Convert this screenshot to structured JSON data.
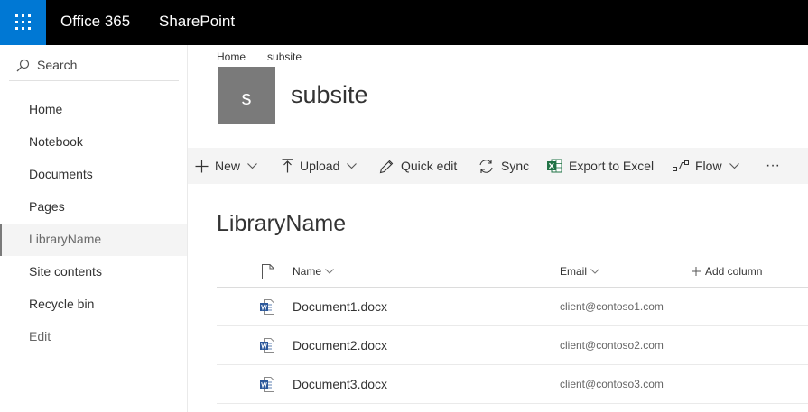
{
  "suite_bar": {
    "brand": "Office 365",
    "app": "SharePoint",
    "colors": {
      "bar": "#000000",
      "waffle": "#0078d4"
    }
  },
  "search": {
    "label": "Search"
  },
  "left_nav": {
    "items": [
      {
        "label": "Home"
      },
      {
        "label": "Notebook"
      },
      {
        "label": "Documents"
      },
      {
        "label": "Pages"
      },
      {
        "label": "LibraryName",
        "selected": true
      },
      {
        "label": "Site contents"
      },
      {
        "label": "Recycle bin"
      },
      {
        "label": "Edit"
      }
    ]
  },
  "breadcrumb": [
    "Home",
    "subsite"
  ],
  "site": {
    "logo_letter": "s",
    "title": "subsite"
  },
  "command_bar": {
    "new": "New",
    "upload": "Upload",
    "quick_edit": "Quick edit",
    "sync": "Sync",
    "export": "Export to Excel",
    "flow": "Flow",
    "more": "···"
  },
  "library": {
    "title": "LibraryName",
    "columns": {
      "name": "Name",
      "email": "Email",
      "add": "Add column"
    },
    "rows": [
      {
        "name": "Document1.docx",
        "email": "client@contoso1.com"
      },
      {
        "name": "Document2.docx",
        "email": "client@contoso2.com"
      },
      {
        "name": "Document3.docx",
        "email": "client@contoso3.com"
      }
    ]
  }
}
